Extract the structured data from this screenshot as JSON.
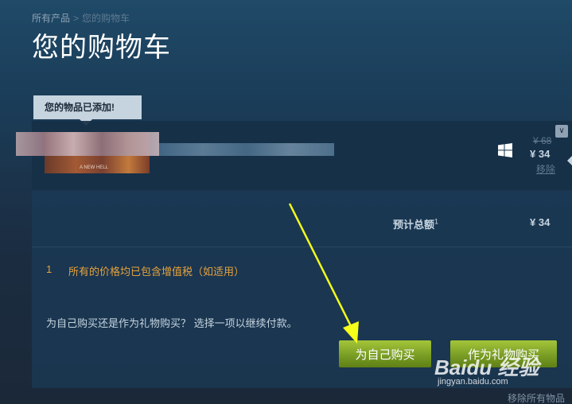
{
  "breadcrumb": {
    "root": "所有产品",
    "separator": ">",
    "current": "您的购物车"
  },
  "page_title": "您的购物车",
  "added_tag": "您的物品已添加!",
  "cart_item": {
    "thumbnail_caption": "A NEW HELL",
    "platform_icon": "windows-icon",
    "original_price": "¥ 68",
    "price": "¥ 34",
    "remove_label": "移除"
  },
  "summary": {
    "total_label": "预计总额",
    "total_footnote": "1",
    "total_value": "¥ 34",
    "note_number": "1",
    "note_text": "所有的价格均已包含增值税（如适用）",
    "question": "为自己购买还是作为礼物购买？ 选择一项以继续付款。"
  },
  "buttons": {
    "buy_self": "为自己购买",
    "buy_gift": "作为礼物购买"
  },
  "remove_all": "移除所有物品",
  "watermark": {
    "logo": "Baidu 经验",
    "url": "jingyan.baidu.com"
  },
  "colors": {
    "accent_green": "#a4c53a",
    "note_orange": "#e6a23c",
    "annotation_arrow": "#f5ff1a"
  }
}
